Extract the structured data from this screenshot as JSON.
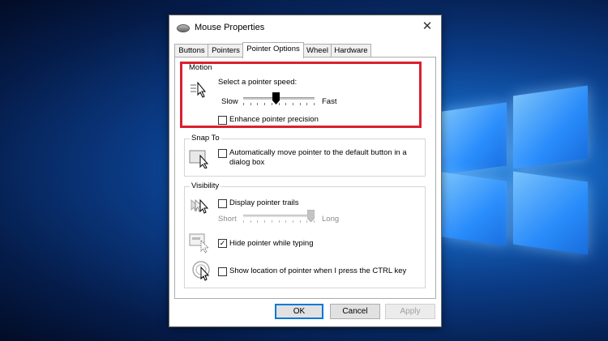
{
  "window": {
    "title": "Mouse Properties",
    "close_glyph": "✕"
  },
  "tabs": [
    {
      "label": "Buttons",
      "active": false
    },
    {
      "label": "Pointers",
      "active": false
    },
    {
      "label": "Pointer Options",
      "active": true
    },
    {
      "label": "Wheel",
      "active": false
    },
    {
      "label": "Hardware",
      "active": false
    }
  ],
  "motion": {
    "group_label": "Motion",
    "prompt": "Select a pointer speed:",
    "slow_label": "Slow",
    "fast_label": "Fast",
    "speed_level": 0.45,
    "enhance_label": "Enhance pointer precision",
    "enhance_checked": false,
    "highlight_color": "#d9202f"
  },
  "snap": {
    "group_label": "Snap To",
    "line1": "Automatically move pointer to the default button in a",
    "line2": "dialog box",
    "checked": false
  },
  "visibility": {
    "group_label": "Visibility",
    "trails_label": "Display pointer trails",
    "trails_checked": false,
    "short_label": "Short",
    "long_label": "Long",
    "trail_level": 1.0,
    "hide_label": "Hide pointer while typing",
    "hide_checked": true,
    "ctrl_label": "Show location of pointer when I press the CTRL key",
    "ctrl_checked": false
  },
  "buttons": {
    "ok": "OK",
    "cancel": "Cancel",
    "apply": "Apply"
  },
  "colors": {
    "accent": "#0078d7"
  }
}
